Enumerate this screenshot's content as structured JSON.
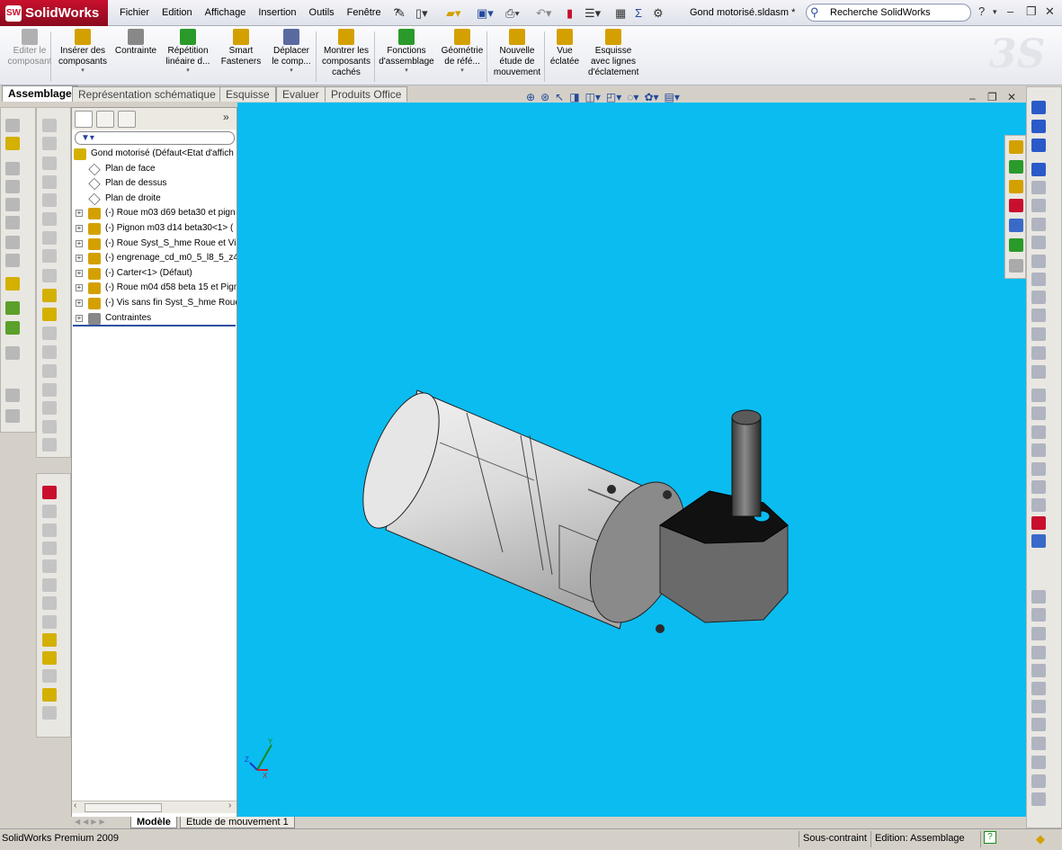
{
  "app": {
    "name": "SolidWorks",
    "document_title": "Gond motorisé.sldasm *"
  },
  "menu": [
    "Fichier",
    "Edition",
    "Affichage",
    "Insertion",
    "Outils",
    "Fenêtre",
    "?"
  ],
  "search": {
    "placeholder": "Recherche SolidWorks"
  },
  "command_manager": [
    {
      "label1": "Editer le",
      "label2": "composant",
      "label3": "",
      "dropdown": false,
      "disabled": true
    },
    {
      "label1": "Insérer des",
      "label2": "composants",
      "label3": "",
      "dropdown": true,
      "disabled": false
    },
    {
      "label1": "Contrainte",
      "label2": "",
      "label3": "",
      "dropdown": false,
      "disabled": false
    },
    {
      "label1": "Répétition",
      "label2": "linéaire d...",
      "label3": "",
      "dropdown": true,
      "disabled": false
    },
    {
      "label1": "Smart",
      "label2": "Fasteners",
      "label3": "",
      "dropdown": false,
      "disabled": false
    },
    {
      "label1": "Déplacer",
      "label2": "le comp...",
      "label3": "",
      "dropdown": true,
      "disabled": false
    },
    {
      "label1": "Montrer les",
      "label2": "composants",
      "label3": "cachés",
      "dropdown": false,
      "disabled": false
    },
    {
      "label1": "Fonctions",
      "label2": "d'assemblage",
      "label3": "",
      "dropdown": true,
      "disabled": false
    },
    {
      "label1": "Géométrie",
      "label2": "de réfé...",
      "label3": "",
      "dropdown": true,
      "disabled": false
    },
    {
      "label1": "Nouvelle",
      "label2": "étude de",
      "label3": "mouvement",
      "dropdown": false,
      "disabled": false
    },
    {
      "label1": "Vue",
      "label2": "éclatée",
      "label3": "",
      "dropdown": false,
      "disabled": false
    },
    {
      "label1": "Esquisse",
      "label2": "avec lignes",
      "label3": "d'éclatement",
      "dropdown": false,
      "disabled": false
    }
  ],
  "tabs": [
    "Assemblage",
    "Représentation schématique",
    "Esquisse",
    "Evaluer",
    "Produits Office"
  ],
  "feature_tree": {
    "root": "Gond motorisé  (Défaut<Etat d'affich",
    "planes": [
      "Plan de face",
      "Plan de dessus",
      "Plan de droite"
    ],
    "components": [
      "(-) Roue m03 d69 beta30 et pign",
      "(-) Pignon m03 d14 beta30<1> (",
      "(-) Roue Syst_S_hme Roue et Vis",
      "(-) engrenage_cd_m0_5_l8_5_z4",
      "(-) Carter<1> (Défaut)",
      "(-) Roue m04 d58 beta 15 et Pign",
      "(-) Vis sans fin Syst_S_hme Roue"
    ],
    "mates": "Contraintes"
  },
  "bottom_tabs": [
    "Modèle",
    "Etude de mouvement 1"
  ],
  "status": {
    "product": "SolidWorks Premium 2009",
    "constraint": "Sous-contraint",
    "mode": "Edition: Assemblage"
  },
  "triad": {
    "x": "X",
    "y": "Y",
    "z": "Z"
  },
  "colors": {
    "viewport_bg": "#0bbcf0",
    "accent_red": "#c8102e"
  }
}
